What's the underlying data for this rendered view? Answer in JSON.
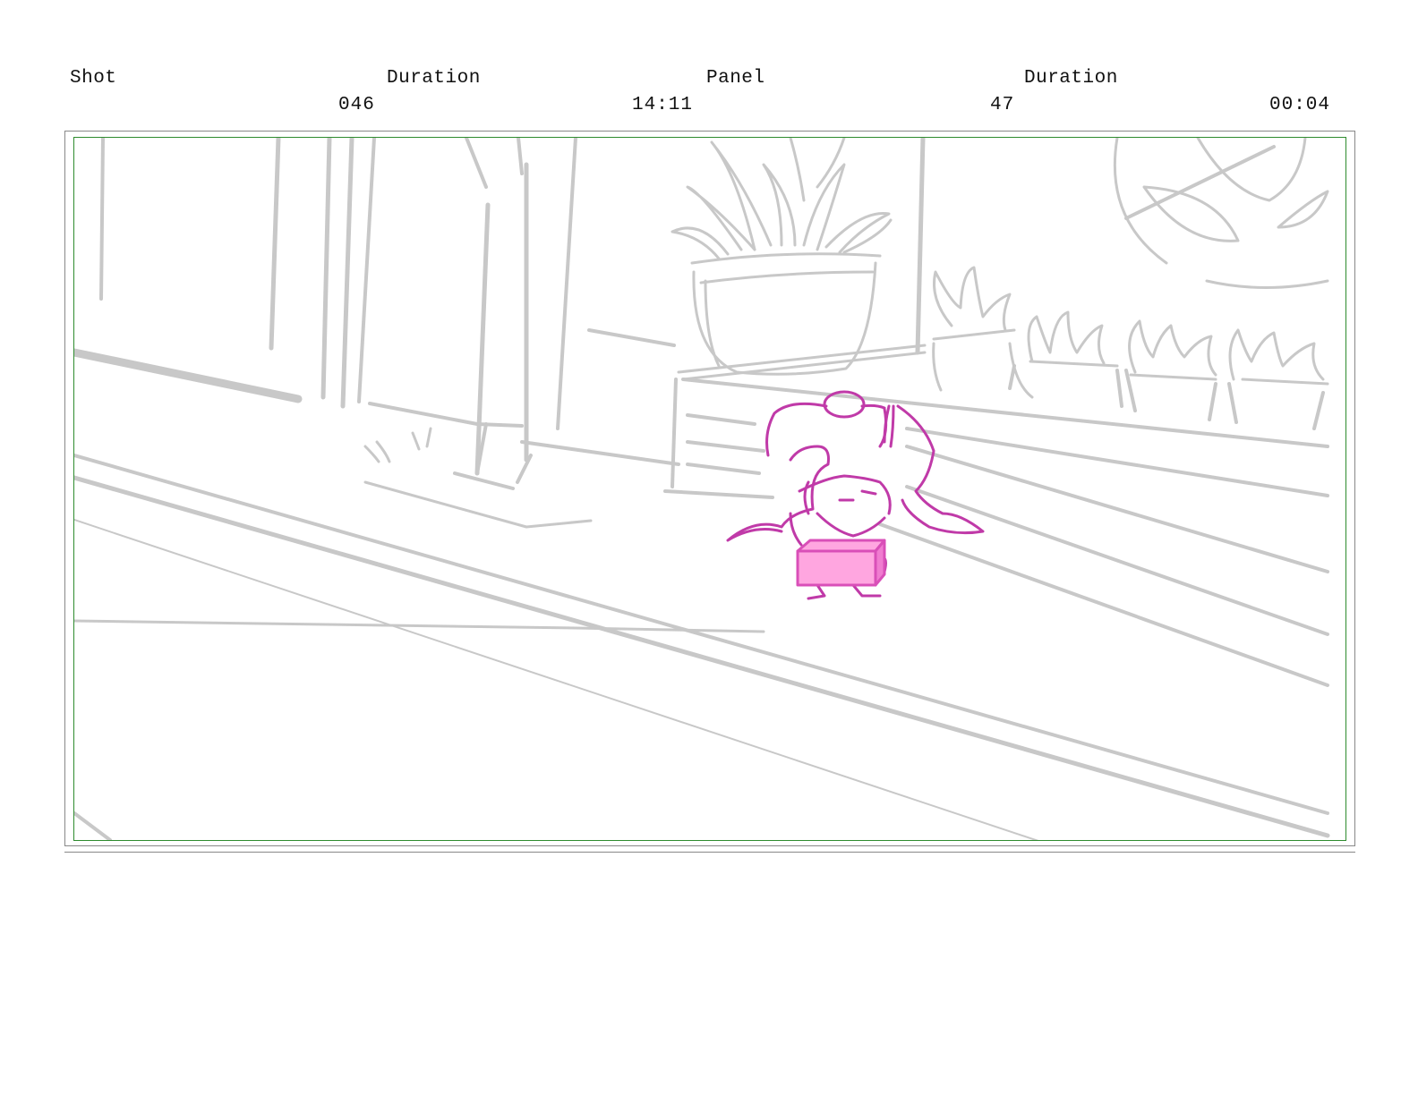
{
  "header": {
    "shot_label": "Shot",
    "duration_label_1": "Duration",
    "panel_label": "Panel",
    "duration_label_2": "Duration"
  },
  "values": {
    "shot": "046",
    "shot_duration": "14:11",
    "panel": "47",
    "panel_duration": "00:04"
  },
  "colors": {
    "frame_border": "#2e8b2e",
    "sketch_gray": "#c8c8c8",
    "character_line": "#c03aa8",
    "box_fill": "#ffa6e0"
  }
}
